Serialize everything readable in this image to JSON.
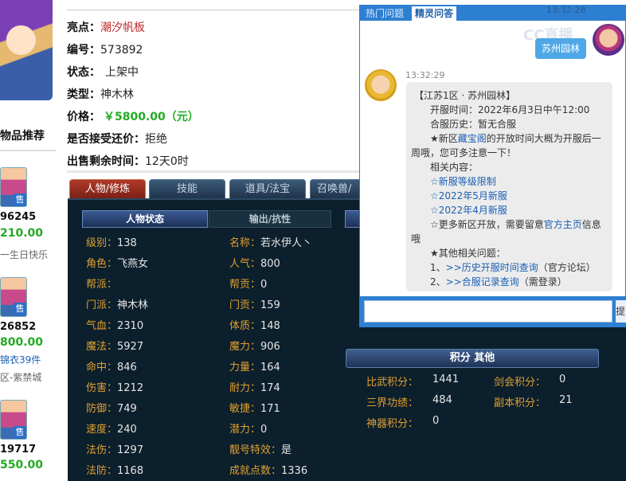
{
  "left": {
    "rec_title": "物品推荐",
    "items": [
      {
        "num": "96245",
        "price": "210.00",
        "text": "一生日快乐",
        "sale": "售"
      },
      {
        "num": "26852",
        "price": "800.00",
        "link": "锦衣39件",
        "text": "区-紫禁城",
        "sale": "售"
      },
      {
        "num": "19717",
        "price": "550.00",
        "sale": "售"
      }
    ]
  },
  "info": {
    "highlight_label": "亮点：",
    "highlight_value": "潮汐帆板",
    "id_label": "编号：",
    "id_value": "573892",
    "status_label": "状态：",
    "status_value": "上架中",
    "type_label": "类型：",
    "type_value": "神木林",
    "price_label": "价格：",
    "price_value": "￥5800.00（元）",
    "bargain_label": "是否接受还价：",
    "bargain_value": "拒绝",
    "remain_label": "出售剩余时间：",
    "remain_value": "12天0时"
  },
  "tabs": [
    "人物/修炼",
    "技能",
    "道具/法宝",
    "召唤兽/"
  ],
  "subtabs": {
    "state": "人物状态",
    "output": "输出/抗性"
  },
  "stats_left": [
    {
      "label": "级别",
      "value": "138"
    },
    {
      "label": "角色",
      "value": "飞燕女"
    },
    {
      "label": "帮派",
      "value": ""
    },
    {
      "label": "门派",
      "value": "神木林"
    },
    {
      "label": "气血",
      "value": "2310"
    },
    {
      "label": "魔法",
      "value": "5927"
    },
    {
      "label": "命中",
      "value": "846"
    },
    {
      "label": "伤害",
      "value": "1212"
    },
    {
      "label": "防御",
      "value": "749"
    },
    {
      "label": "速度",
      "value": "240"
    },
    {
      "label": "法伤",
      "value": "1297"
    },
    {
      "label": "法防",
      "value": "1168"
    }
  ],
  "stats_right": [
    {
      "label": "名称",
      "value": "若水伊人丶"
    },
    {
      "label": "人气",
      "value": "800"
    },
    {
      "label": "帮贡",
      "value": "0"
    },
    {
      "label": "门贡",
      "value": "159"
    },
    {
      "label": "体质",
      "value": "148"
    },
    {
      "label": "魔力",
      "value": "906"
    },
    {
      "label": "力量",
      "value": "164"
    },
    {
      "label": "耐力",
      "value": "174"
    },
    {
      "label": "敏捷",
      "value": "171"
    },
    {
      "label": "潜力",
      "value": "0"
    },
    {
      "label": "靓号特效",
      "value": "是"
    },
    {
      "label": "成就点数",
      "value": "1336"
    }
  ],
  "score": {
    "title": "积分 其他",
    "biwu_label": "比武积分：",
    "biwu_value": "1441",
    "jianhui_label": "剑会积分：",
    "jianhui_value": "0",
    "sanjie_label": "三界功绩：",
    "sanjie_value": "484",
    "fuben_label": "副本积分：",
    "fuben_value": "21",
    "shenqi_label": "神器积分：",
    "shenqi_value": "0"
  },
  "chat": {
    "tab_hot": "热门问题",
    "tab_ai": "精灵问答",
    "my_message": "苏州园林",
    "my_time": "13:32:28",
    "watermark": "CC直播",
    "reply_time": "13:32:29",
    "reply": {
      "title": "【江苏1区 · 苏州园林】",
      "open_time": "开服时间：2022年6月3日中午12:00",
      "merge": "合服历史：暂无合服",
      "new_zone_a": "★新区",
      "new_zone_link": "藏宝阁",
      "new_zone_b": "的开放时间大概为开服后一",
      "new_zone_c": "周哦，您可多注意一下！",
      "related": "相关内容：",
      "link1": "☆新服等级限制",
      "link2": "☆2022年5月新服",
      "link3": "☆2022年4月新服",
      "more_a": "☆更多新区开放，需要留意",
      "more_link": "官方主页",
      "more_b": "信息",
      "more_c": "哦",
      "other": "★其他相关问题：",
      "q1_prefix": "1、",
      "q1_link": ">>历史开服时间查询",
      "q1_note": "（官方论坛）",
      "q2_prefix": "2、",
      "q2_link": ">>合服记录查询",
      "q2_note": "（需登录）"
    },
    "send_label": "提"
  }
}
